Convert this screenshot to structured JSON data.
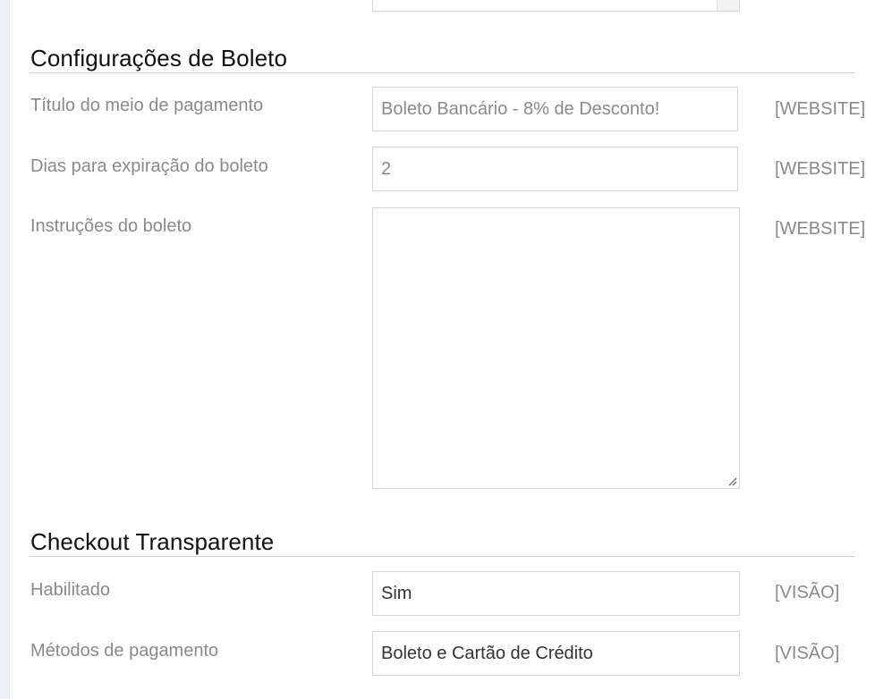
{
  "boleto_section": {
    "title": "Configurações de Boleto",
    "fields": [
      {
        "label": "Título do meio de pagamento",
        "value": "Boleto Bancário - 8% de Desconto!",
        "scope": "[WEBSITE]"
      },
      {
        "label": "Dias para expiração do boleto",
        "value": "2",
        "scope": "[WEBSITE]"
      },
      {
        "label": "Instruções do boleto",
        "value": "",
        "scope": "[WEBSITE]"
      }
    ]
  },
  "checkout_section": {
    "title": "Checkout Transparente",
    "fields": [
      {
        "label": "Habilitado",
        "value": "Sim",
        "scope": "[VISÃO]"
      },
      {
        "label": "Métodos de pagamento",
        "value": "Boleto e Cartão de Crédito",
        "scope": "[VISÃO]"
      }
    ]
  },
  "icons": {
    "textarea_resize": "resize-grip-icon"
  }
}
